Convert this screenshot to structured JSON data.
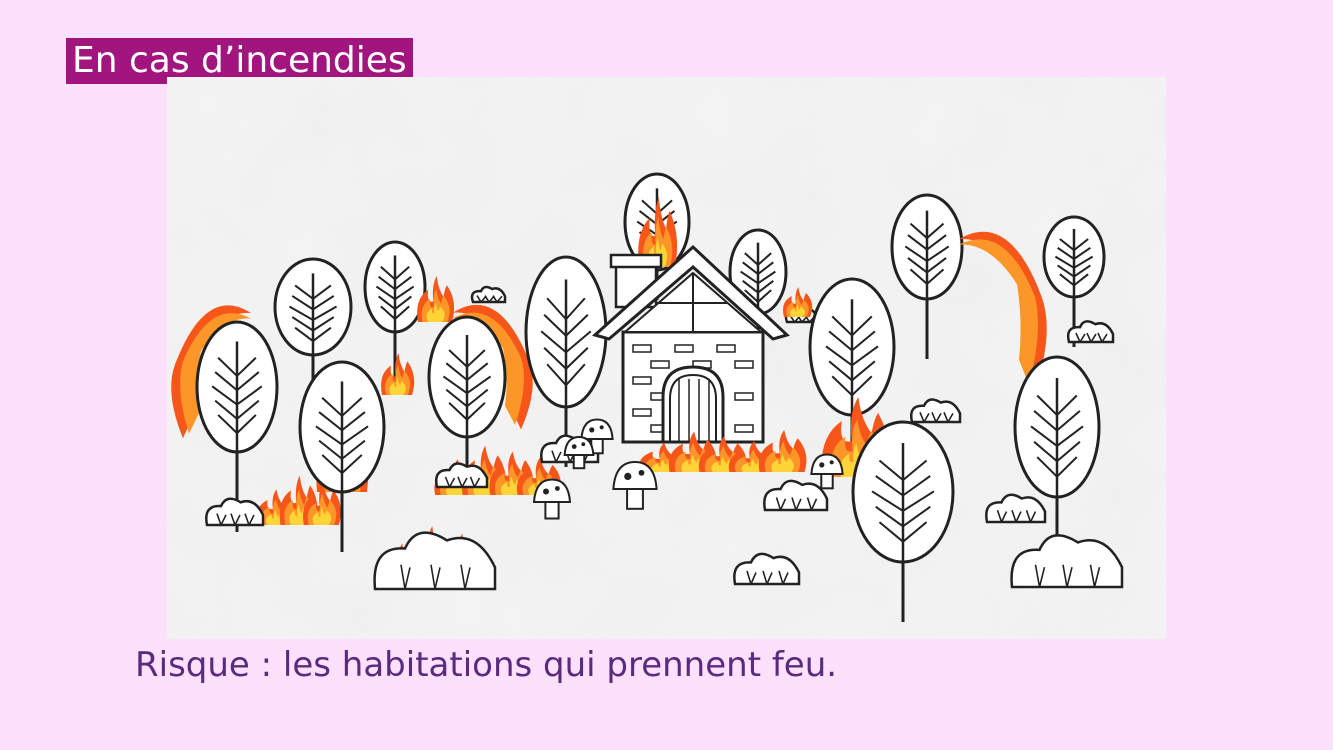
{
  "slide": {
    "title": "En cas d’incendies",
    "caption": "Risque : les habitations qui prennent feu."
  },
  "colors": {
    "background": "#fde0fb",
    "title_badge": "#a3157e",
    "caption_text": "#5a2a7e",
    "flame_outer": "#f7561b",
    "flame_mid": "#fd9628",
    "flame_inner": "#fed536"
  },
  "illustration": {
    "subject": "house-on-fire-in-forest"
  }
}
